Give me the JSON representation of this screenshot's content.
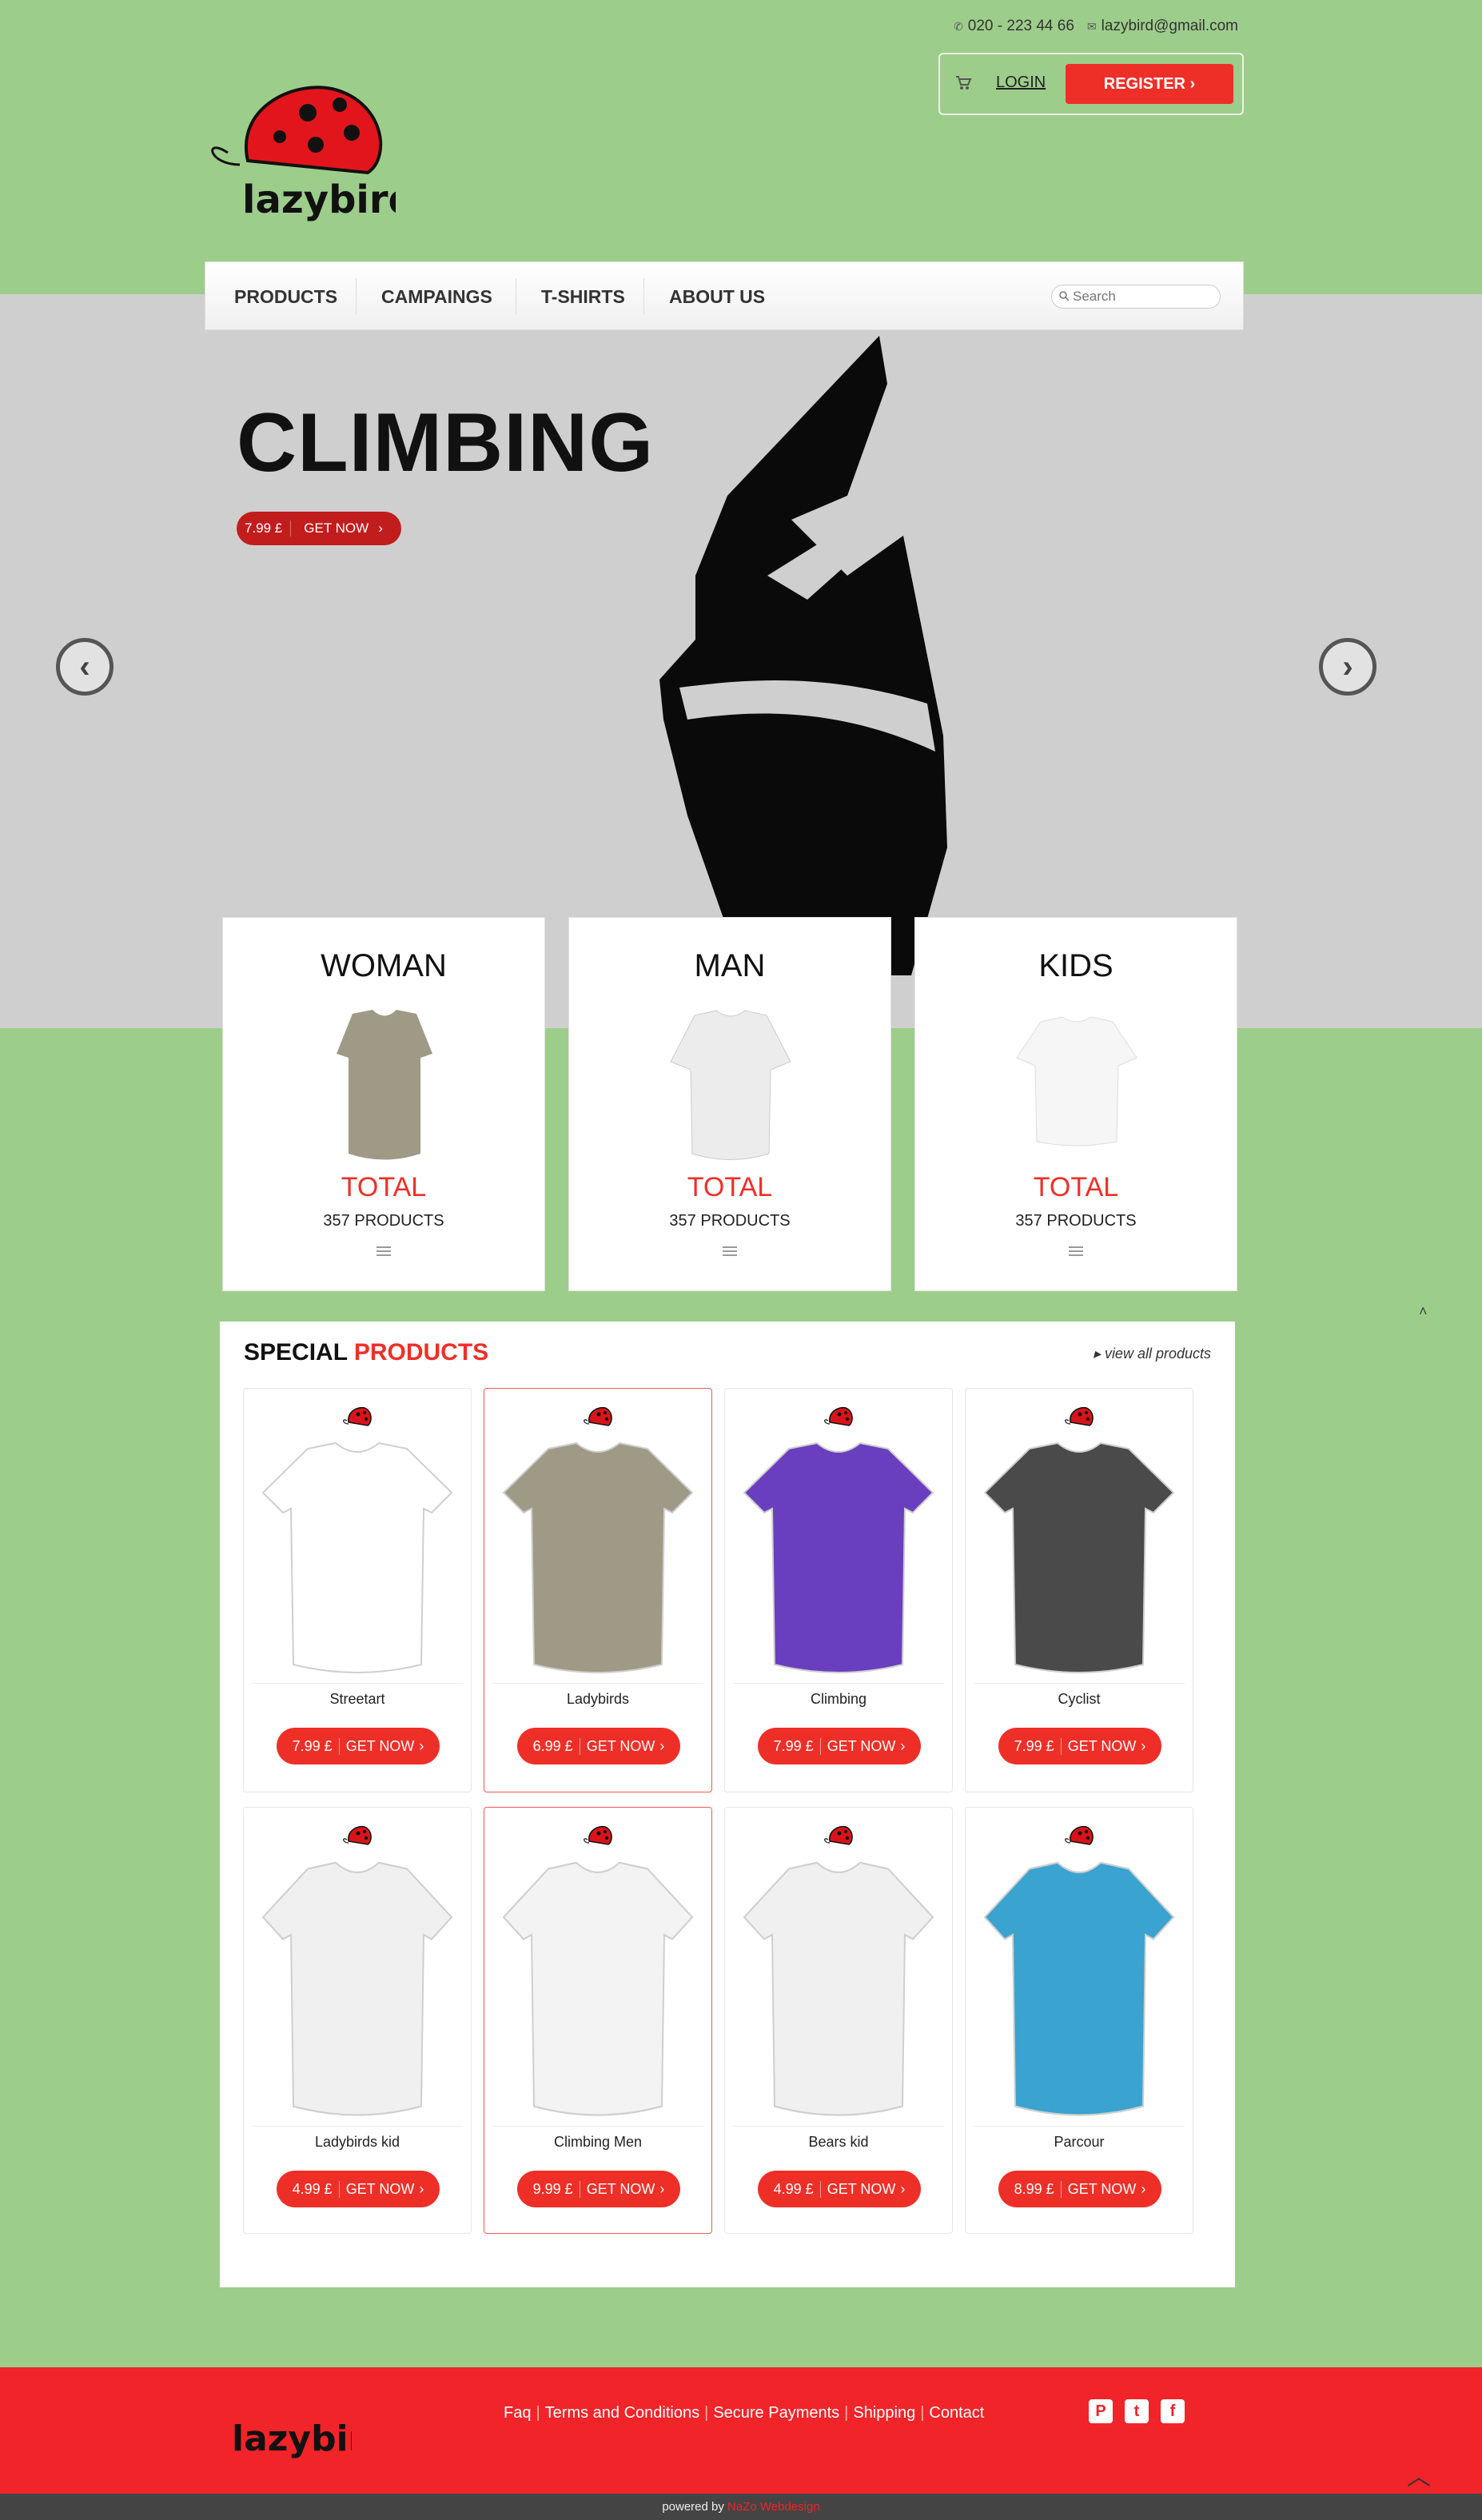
{
  "header": {
    "phone": "020 - 223 44 66",
    "email": "lazybird@gmail.com",
    "login": "LOGIN",
    "register": "REGISTER ›"
  },
  "brand": {
    "name": "lazybird",
    "accent": "#ee2f28",
    "background": "#9dcd8b"
  },
  "nav": {
    "items": [
      "PRODUCTS",
      "CAMPAINGS",
      "T-SHIRTS",
      "ABOUT US"
    ],
    "search_placeholder": "Search"
  },
  "hero": {
    "title": "CLIMBING",
    "price": "7.99 £",
    "cta": "GET NOW",
    "prev_icon": "chevron-left-icon",
    "next_icon": "chevron-right-icon"
  },
  "categories": [
    {
      "name": "WOMAN",
      "total": "TOTAL",
      "count": "357 PRODUCTS",
      "color": "#9e9a86"
    },
    {
      "name": "MAN",
      "total": "TOTAL",
      "count": "357 PRODUCTS",
      "color": "#e8e8e8"
    },
    {
      "name": "KIDS",
      "total": "TOTAL",
      "count": "357 PRODUCTS",
      "color": "#f6f6f6"
    }
  ],
  "specials": {
    "title_a": "SPECIAL",
    "title_b": "PRODUCTS",
    "view_all": "view all products",
    "products": [
      {
        "name": "Streetart",
        "price": "7.99 £",
        "cta": "GET NOW",
        "color": "#ffffff"
      },
      {
        "name": "Ladybirds",
        "price": "6.99 £",
        "cta": "GET NOW",
        "color": "#9e9a86"
      },
      {
        "name": "Climbing",
        "price": "7.99 £",
        "cta": "GET NOW",
        "color": "#6a3fbf"
      },
      {
        "name": "Cyclist",
        "price": "7.99 £",
        "cta": "GET NOW",
        "color": "#4a4a4a"
      },
      {
        "name": "Ladybirds kid",
        "price": "4.99 £",
        "cta": "GET NOW",
        "color": "#f0f0f0"
      },
      {
        "name": "Climbing Men",
        "price": "9.99 £",
        "cta": "GET NOW",
        "color": "#f3f3f3"
      },
      {
        "name": "Bears kid",
        "price": "4.99 £",
        "cta": "GET NOW",
        "color": "#f0f0f0"
      },
      {
        "name": "Parcour",
        "price": "8.99 £",
        "cta": "GET NOW",
        "color": "#3aa3cf"
      }
    ]
  },
  "footer": {
    "links": [
      "Faq",
      "Terms and Conditions",
      "Secure Payments",
      "Shipping",
      "Contact"
    ],
    "social": [
      "pinterest-icon",
      "twitter-icon",
      "facebook-icon"
    ],
    "powered_by": "powered by",
    "powered_name": "NaZo Webdesign"
  }
}
